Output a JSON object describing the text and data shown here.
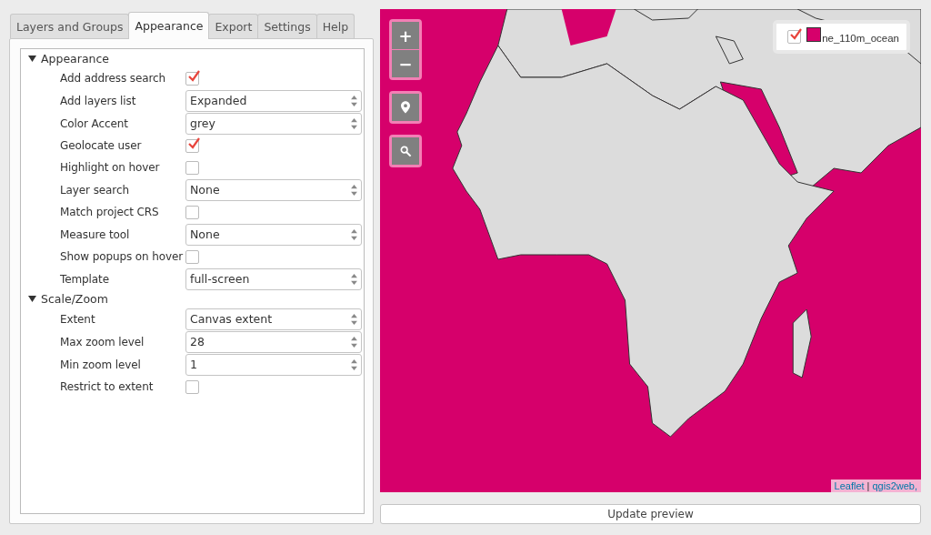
{
  "tabs": [
    {
      "label": "Layers and Groups",
      "selected": false
    },
    {
      "label": "Appearance",
      "selected": true
    },
    {
      "label": "Export",
      "selected": false
    },
    {
      "label": "Settings",
      "selected": false
    },
    {
      "label": "Help",
      "selected": false
    }
  ],
  "tree": [
    {
      "label": "Appearance",
      "expanded": true,
      "children": [
        {
          "label": "Add address search",
          "kind": "checkbox",
          "checked": true
        },
        {
          "label": "Add layers list",
          "kind": "select",
          "value": "Expanded"
        },
        {
          "label": "Color Accent",
          "kind": "select",
          "value": "grey"
        },
        {
          "label": "Geolocate user",
          "kind": "checkbox",
          "checked": true
        },
        {
          "label": "Highlight on hover",
          "kind": "checkbox",
          "checked": false
        },
        {
          "label": "Layer search",
          "kind": "select",
          "value": "None"
        },
        {
          "label": "Match project CRS",
          "kind": "checkbox",
          "checked": false
        },
        {
          "label": "Measure tool",
          "kind": "select",
          "value": "None"
        },
        {
          "label": "Show popups on hover",
          "kind": "checkbox",
          "checked": false
        },
        {
          "label": "Template",
          "kind": "select",
          "value": "full-screen"
        }
      ]
    },
    {
      "label": "Scale/Zoom",
      "expanded": true,
      "children": [
        {
          "label": "Extent",
          "kind": "select",
          "value": "Canvas extent"
        },
        {
          "label": "Max zoom level",
          "kind": "select",
          "value": "28"
        },
        {
          "label": "Min zoom level",
          "kind": "select",
          "value": "1"
        },
        {
          "label": "Restrict to extent",
          "kind": "checkbox",
          "checked": false
        }
      ]
    }
  ],
  "map": {
    "zoom_in": "+",
    "zoom_out": "−",
    "legend": {
      "label": "ne_110m_ocean",
      "checked": true,
      "color": "#d6006b"
    },
    "attribution": [
      {
        "text": "Leaflet",
        "kind": "link"
      },
      {
        "text": "|",
        "kind": "sep"
      },
      {
        "text": "qgis2web,",
        "kind": "link"
      }
    ]
  },
  "update_button": "Update preview"
}
